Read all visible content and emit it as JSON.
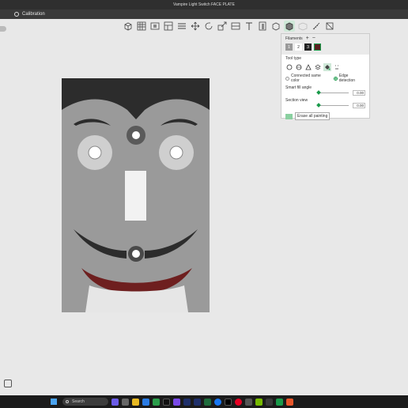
{
  "window": {
    "title": "Vampire Light Switch FACE PLATE"
  },
  "tabs": [
    {
      "label": "Calibration"
    }
  ],
  "toolbar": {
    "icons": [
      "add-cube-icon",
      "grid-icon",
      "orient-icon",
      "arrange-icon",
      "split-icon",
      "move-icon",
      "rotate-icon",
      "scale-icon",
      "cut-icon",
      "text-icon",
      "support-paint-icon",
      "seam-paint-icon",
      "color-paint-icon",
      "emboss-icon",
      "measure-icon",
      "assembly-icon"
    ]
  },
  "paint_panel": {
    "filaments_label": "Filaments",
    "add_label": "+",
    "remove_label": "−",
    "filaments": [
      "1",
      "2",
      "3",
      ""
    ],
    "tool_type_label": "Tool type",
    "connected_same_color": "Connected same color",
    "edge_detection": "Edge detection",
    "smart_fill_angle_label": "Smart fill angle",
    "smart_fill_angle_value": "0.00",
    "section_view_label": "Section view",
    "section_view_value": "0.00",
    "erase_all_label": "Erase all painting"
  },
  "taskbar": {
    "search_placeholder": "Search"
  },
  "colors": {
    "accent": "#1a9a4a",
    "plate": "#9a9a9a",
    "hair": "#2c2c2c",
    "lips": "#6e1f1f"
  }
}
